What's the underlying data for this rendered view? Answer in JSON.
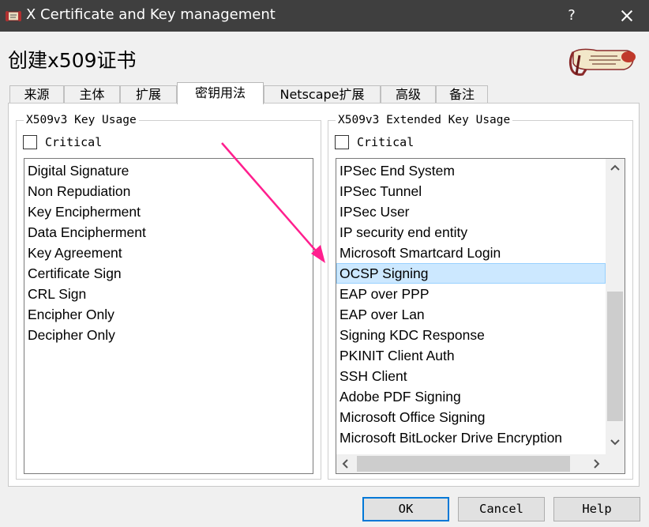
{
  "window": {
    "title": "X Certificate and Key management",
    "help_glyph": "?",
    "heading": "创建x509证书"
  },
  "tabs": [
    {
      "label": "来源"
    },
    {
      "label": "主体"
    },
    {
      "label": "扩展"
    },
    {
      "label": "密钥用法",
      "active": true
    },
    {
      "label": "Netscape扩展"
    },
    {
      "label": "高级"
    },
    {
      "label": "备注"
    }
  ],
  "key_usage": {
    "title": "X509v3 Key Usage",
    "critical_label": "Critical",
    "critical_checked": false,
    "items": [
      "Digital Signature",
      "Non Repudiation",
      "Key Encipherment",
      "Data Encipherment",
      "Key Agreement",
      "Certificate Sign",
      "CRL Sign",
      "Encipher Only",
      "Decipher Only"
    ]
  },
  "extended_key_usage": {
    "title": "X509v3 Extended Key Usage",
    "critical_label": "Critical",
    "critical_checked": false,
    "selected": "OCSP Signing",
    "items": [
      "IPSec End System",
      "IPSec Tunnel",
      "IPSec User",
      "IP security end entity",
      "Microsoft Smartcard Login",
      "OCSP Signing",
      "EAP over PPP",
      "EAP over Lan",
      "Signing KDC Response",
      "PKINIT Client Auth",
      "SSH Client",
      "Adobe PDF Signing",
      "Microsoft Office Signing",
      "Microsoft BitLocker Drive Encryption"
    ]
  },
  "buttons": {
    "ok": "OK",
    "cancel": "Cancel",
    "help": "Help"
  },
  "colors": {
    "titlebar": "#3f3f3f",
    "selection": "#cce8ff",
    "default_button_border": "#0078d7",
    "annotation_arrow": "#ff1f8e"
  },
  "icons": {
    "app": "certificate-scroll-icon",
    "close": "close-icon",
    "logo": "xca-scroll-logo"
  }
}
